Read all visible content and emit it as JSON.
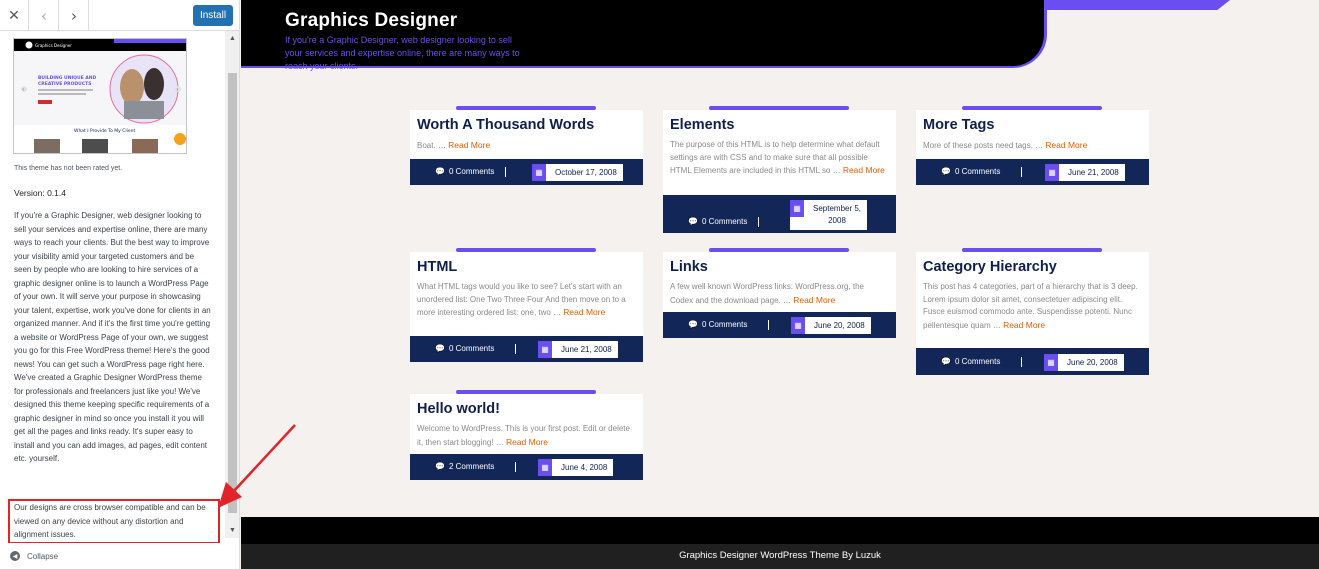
{
  "toolbar": {
    "close_glyph": "✕",
    "prev_glyph": "‹",
    "next_glyph": "›",
    "install_label": "Install"
  },
  "theme": {
    "thumbnail": {
      "logo_text": "Graphics Designer",
      "hero_line1": "BUILDING UNIQUE AND",
      "hero_line2": "CREATIVE PRODUCTS",
      "section_title": "What I Provide To My Client"
    },
    "rating_text": "This theme has not been rated yet.",
    "version_text": "Version: 0.1.4",
    "description": "If you're a Graphic Designer, web designer looking to sell your services and expertise online, there are many ways to reach your clients. But the best way to improve your visibility amid your targeted customers and be seen by people who are looking to hire services of a graphic designer online is to launch a WordPress Page of your own. It will serve your purpose in showcasing your talent, expertise, work you've done for clients in an organized manner. And if it's the first time you're getting a website or WordPress Page of your own, we suggest you go for this Free WordPress theme! Here's the good news! You can get such a WordPress page right here. We've created a Graphic Designer WordPress theme for professionals and freelancers just like you! We've designed this theme keeping specific requirements of a graphic designer in mind so once you install it you will get all the pages and links ready. It's super easy to install and you can add images, ad pages, edit content etc. yourself.",
    "description_highlight": "Our designs are cross browser compatible and can be viewed on any device without any distortion and alignment issues."
  },
  "collapse_label": "Collapse",
  "annotation": {
    "highlight_color": "#e1242a"
  },
  "site": {
    "title": "Graphics Designer",
    "tagline": "If you're a Graphic Designer, web designer looking to sell your services and expertise online, there are many ways to reach your clients.",
    "accent_color": "#6a4ef0",
    "navy_color": "#122657",
    "read_more_color": "#e35d00"
  },
  "posts": [
    {
      "title": "Worth A Thousand Words",
      "excerpt": "Boat. … ",
      "read_more": "Read More",
      "comments": "0 Comments",
      "date": "October 17, 2008"
    },
    {
      "title": "Elements",
      "excerpt": "The purpose of this HTML is to help determine what default settings are with CSS and to make sure that all possible HTML Elements are included in this HTML so … ",
      "read_more": "Read More",
      "comments": "0 Comments",
      "date_line1": "September 5,",
      "date_line2": "2008"
    },
    {
      "title": "More Tags",
      "excerpt": "More of these posts need tags. … ",
      "read_more": "Read More",
      "comments": "0 Comments",
      "date": "June 21, 2008"
    },
    {
      "title": "HTML",
      "excerpt": "What HTML tags would you like to see? Let's start with an unordered list: One Two Three Four And then move on to a more interesting ordered list: one, two … ",
      "read_more": "Read More",
      "comments": "0 Comments",
      "date": "June 21, 2008"
    },
    {
      "title": "Links",
      "excerpt": "A few well known WordPress links: WordPress.org, the Codex and the download page. … ",
      "read_more": "Read More",
      "comments": "0 Comments",
      "date": "June 20, 2008"
    },
    {
      "title": "Category Hierarchy",
      "excerpt": "This post has 4 categories, part of a hierarchy that is 3 deep. Lorem ipsum dolor sit amet, consectetuer adipiscing elit. Fusce euismod commodo ante. Suspendisse potenti. Nunc pellentesque quam … ",
      "read_more": "Read More",
      "comments": "0 Comments",
      "date": "June 20, 2008"
    },
    {
      "title": "Hello world!",
      "excerpt": "Welcome to WordPress. This is your first post. Edit or delete it, then start blogging! … ",
      "read_more": "Read More",
      "comments": "2 Comments",
      "date": "June 4, 2008"
    }
  ],
  "footer": {
    "text": "Graphics Designer WordPress Theme By Luzuk"
  }
}
